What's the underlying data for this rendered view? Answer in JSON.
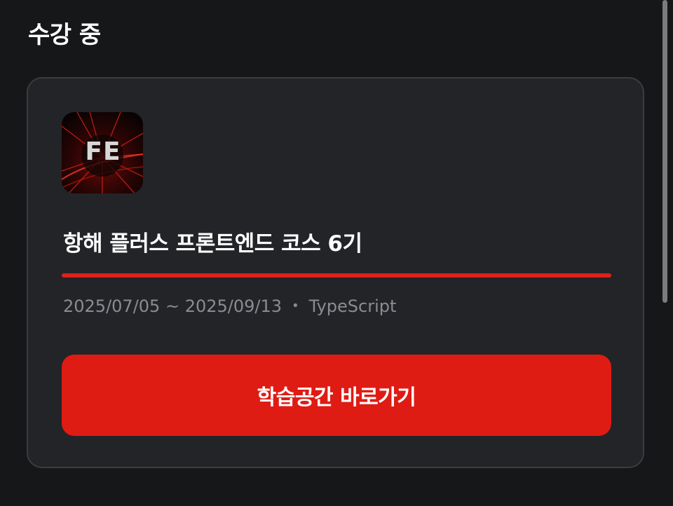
{
  "section": {
    "title": "수강 중"
  },
  "course": {
    "logo_text": "FE",
    "title": "항해 플러스 프론트엔드 코스 6기",
    "progress_fraction": 1.0,
    "date_range": "2025/07/05 ~ 2025/09/13",
    "separator": "•",
    "tech": "TypeScript",
    "cta_label": "학습공간 바로가기"
  },
  "colors": {
    "background": "#161719",
    "card": "#232428",
    "accent": "#df1c14",
    "muted_text": "#8a8c91"
  }
}
